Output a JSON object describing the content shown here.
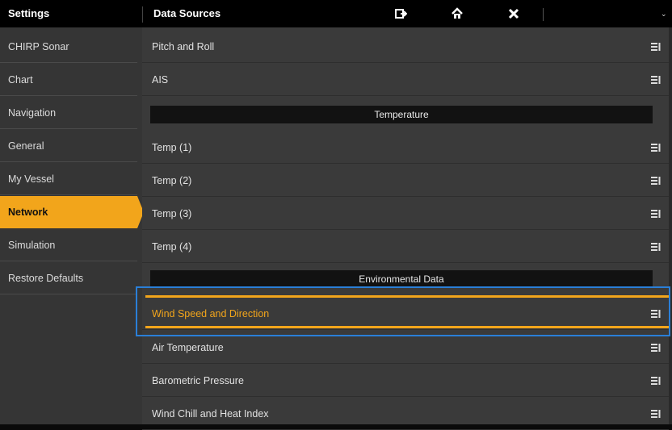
{
  "header": {
    "left_title": "Settings",
    "right_title": "Data Sources",
    "icons": [
      "exit-icon",
      "home-icon",
      "close-icon"
    ],
    "chevron": "⌄"
  },
  "sidebar": {
    "items": [
      {
        "label": "CHIRP Sonar"
      },
      {
        "label": "Chart"
      },
      {
        "label": "Navigation"
      },
      {
        "label": "General"
      },
      {
        "label": "My Vessel"
      },
      {
        "label": "Network",
        "active": true
      },
      {
        "label": "Simulation"
      },
      {
        "label": "Restore Defaults"
      }
    ]
  },
  "content": {
    "rows_top": [
      {
        "label": "Pitch and Roll"
      },
      {
        "label": "AIS"
      }
    ],
    "section_temperature": "Temperature",
    "rows_temperature": [
      {
        "label": "Temp (1)"
      },
      {
        "label": "Temp (2)"
      },
      {
        "label": "Temp (3)"
      },
      {
        "label": "Temp (4)"
      }
    ],
    "section_environmental": "Environmental Data",
    "rows_environmental": [
      {
        "label": "Wind Speed and Direction",
        "selected": true
      },
      {
        "label": "Air Temperature"
      },
      {
        "label": "Barometric Pressure"
      },
      {
        "label": "Wind Chill and Heat Index"
      }
    ]
  },
  "colors": {
    "accent": "#f2a51b",
    "focus": "#2a7fd8",
    "background": "#3a3a3a",
    "sidebar": "#353535"
  }
}
